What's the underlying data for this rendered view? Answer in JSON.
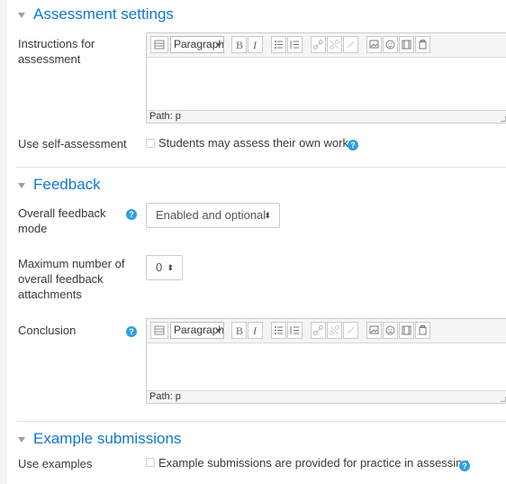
{
  "sections": {
    "assessment": {
      "title": "Assessment settings"
    },
    "feedback": {
      "title": "Feedback"
    },
    "examples": {
      "title": "Example submissions"
    }
  },
  "assessment": {
    "instructions_label": "Instructions for assessment",
    "editor": {
      "paragraph": "Paragraph",
      "path": "Path: p"
    },
    "self_label": "Use self-assessment",
    "self_checkbox": "Students may assess their own work"
  },
  "feedback": {
    "mode_label": "Overall feedback mode",
    "mode_value": "Enabled and optional",
    "max_label": "Maximum number of overall feedback attachments",
    "max_value": "0",
    "conclusion_label": "Conclusion",
    "editor": {
      "paragraph": "Paragraph",
      "path": "Path: p"
    }
  },
  "examples": {
    "label": "Use examples",
    "checkbox": "Example submissions are provided for practice in assessing"
  },
  "icons": {
    "help": "?",
    "select_arrow": "⬍",
    "collapse": "caret-down-icon"
  },
  "colors": {
    "heading": "#1177d1",
    "help": "#2ea0e0"
  }
}
